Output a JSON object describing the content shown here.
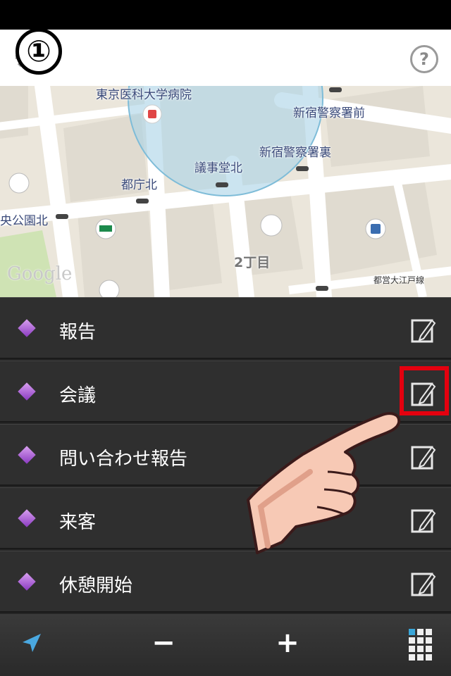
{
  "header": {
    "step_badge": "①",
    "help_glyph": "?",
    "icons": {
      "settings": "gear-icon",
      "help": "question-icon"
    }
  },
  "map": {
    "labels": {
      "hospital": "東京医科大学病院",
      "police_front": "新宿警察署前",
      "police_back": "新宿警察署裏",
      "gijidou": "議事堂北",
      "tochou": "都庁北",
      "park": "央公園北",
      "district": "2丁目",
      "line": "都営大江戸線"
    },
    "attribution": "Google"
  },
  "list": {
    "items": [
      {
        "label": "報告"
      },
      {
        "label": "会議"
      },
      {
        "label": "問い合わせ報告"
      },
      {
        "label": "来客"
      },
      {
        "label": "休憩開始"
      }
    ],
    "highlighted_index": 1,
    "highlight_color": "#e4000f"
  },
  "toolbar": {
    "zoom_out_label": "−",
    "zoom_in_label": "+",
    "icons": {
      "locate": "location-arrow-icon",
      "menu": "grid-icon"
    }
  }
}
